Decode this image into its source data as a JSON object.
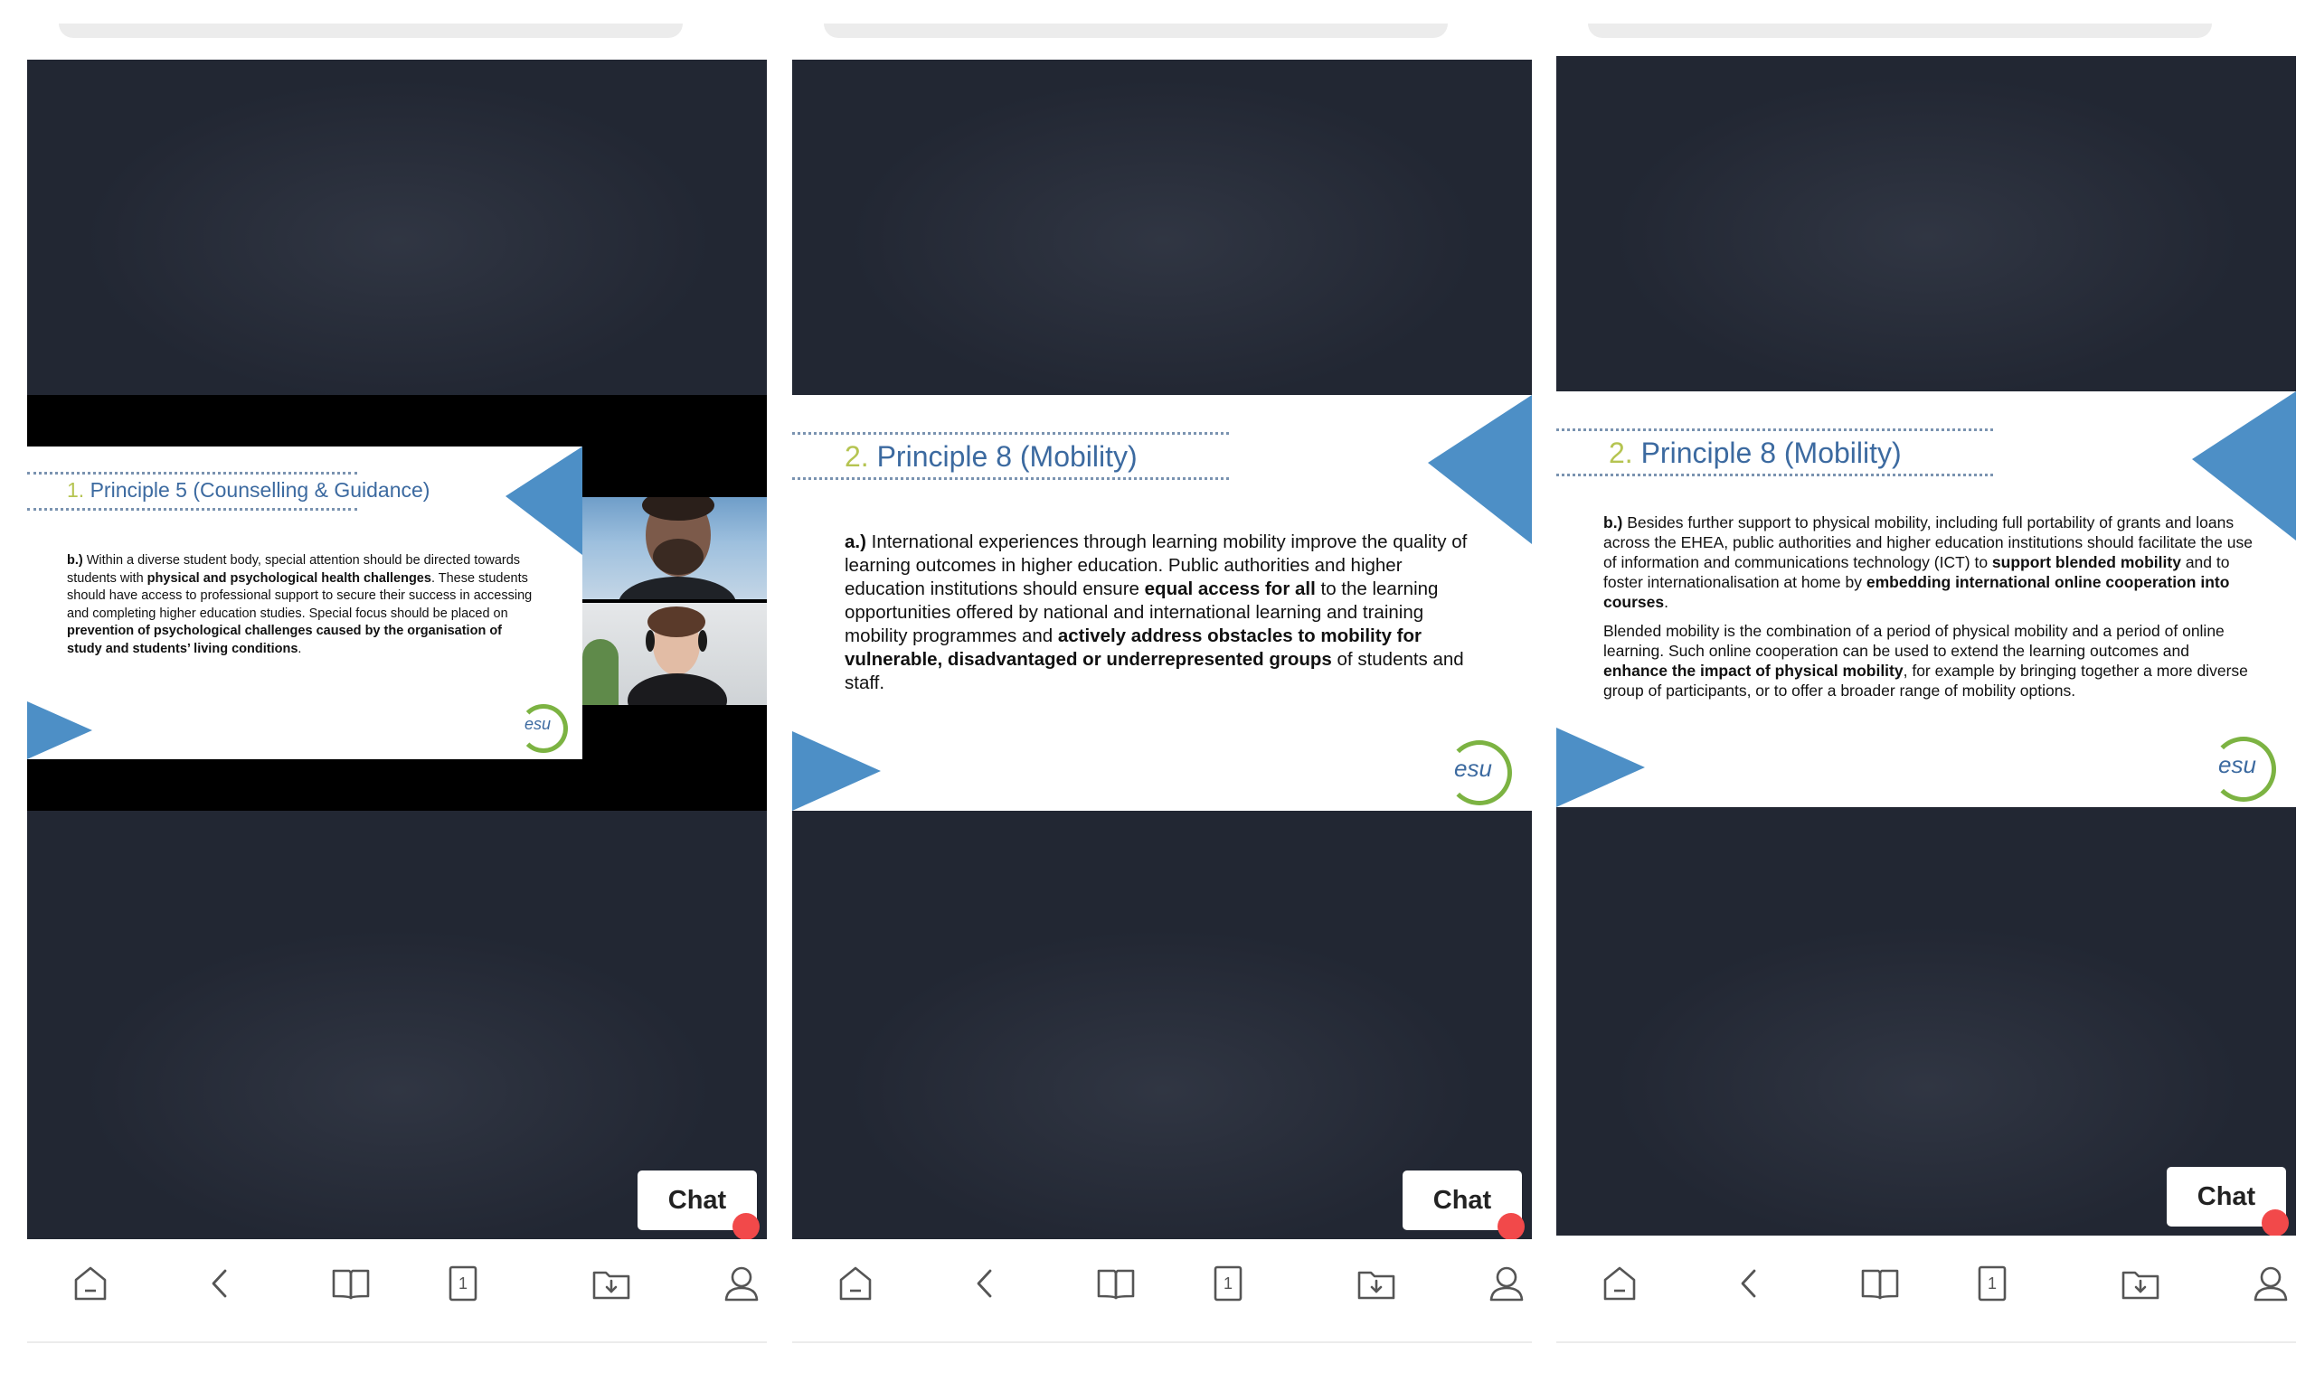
{
  "colors": {
    "video_bg": "#222733",
    "slide_title": "#3c6aa0",
    "slide_number": "#b5c451",
    "chat_badge": "#f2494a",
    "logo_green": "#7cb342"
  },
  "panels": [
    {
      "slide": {
        "number": "1.",
        "title": "Principle 5 (Counselling & Guidance)",
        "paragraphs": [
          [
            {
              "t": "b.)",
              "b": true
            },
            {
              "t": " Within a diverse student body, special attention should be directed towards students with "
            },
            {
              "t": "physical and psychological health challenges",
              "b": true
            },
            {
              "t": ". These students should have access to professional support to secure their success in accessing and completing higher education studies. Special focus should be placed on "
            },
            {
              "t": "prevention of psychological challenges caused by the organisation of study and students’ living conditions",
              "b": true
            },
            {
              "t": "."
            }
          ]
        ],
        "logo_text": "esu"
      },
      "chat_label": "Chat"
    },
    {
      "slide": {
        "number": "2.",
        "title": "Principle 8 (Mobility)",
        "paragraphs": [
          [
            {
              "t": "a.)",
              "b": true
            },
            {
              "t": " International experiences through learning mobility improve the quality of learning outcomes in higher education. Public authorities and higher education institutions should ensure "
            },
            {
              "t": "equal access for all",
              "b": true
            },
            {
              "t": " to the learning opportunities offered by national and international learning and training mobility programmes and "
            },
            {
              "t": "actively address obstacles to mobility for vulnerable, disadvantaged or underrepresented groups",
              "b": true
            },
            {
              "t": " of students and staff."
            }
          ]
        ],
        "logo_text": "esu"
      },
      "chat_label": "Chat"
    },
    {
      "slide": {
        "number": "2.",
        "title": "Principle 8 (Mobility)",
        "paragraphs": [
          [
            {
              "t": "b.)",
              "b": true
            },
            {
              "t": " Besides further support to physical mobility, including full portability of grants and loans across the EHEA, public authorities and higher education institutions should facilitate the use of information and communications technology (ICT) to "
            },
            {
              "t": "support blended mobility",
              "b": true
            },
            {
              "t": " and to foster internationalisation at home by "
            },
            {
              "t": "embedding international online cooperation into courses",
              "b": true
            },
            {
              "t": "."
            }
          ],
          [
            {
              "t": "Blended mobility is the combination of a period of physical mobility and a period of online learning. Such online cooperation can be used to extend the learning outcomes and "
            },
            {
              "t": "enhance the impact of physical mobility",
              "b": true
            },
            {
              "t": ", for example by bringing together a more diverse group of participants, or to offer a broader range of mobility options."
            }
          ]
        ],
        "logo_text": "esu"
      },
      "chat_label": "Chat"
    }
  ],
  "nav_items": [
    {
      "icon": "home-icon"
    },
    {
      "icon": "back-chevron-icon"
    },
    {
      "icon": "book-icon"
    },
    {
      "icon": "page-counter-icon",
      "label": "1"
    },
    {
      "icon": "download-folder-icon"
    },
    {
      "icon": "profile-icon"
    }
  ]
}
